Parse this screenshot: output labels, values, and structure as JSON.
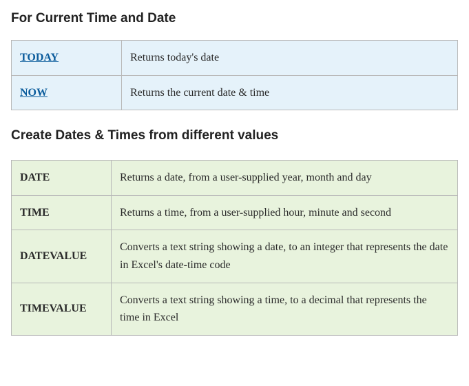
{
  "section1": {
    "heading": "For Current Time and Date",
    "rows": [
      {
        "name": "TODAY",
        "desc": "Returns today's date"
      },
      {
        "name": "NOW",
        "desc": "Returns the current date & time"
      }
    ]
  },
  "section2": {
    "heading": "Create Dates & Times from different values",
    "rows": [
      {
        "name": "DATE",
        "desc": "Returns a date, from a user-supplied year, month and day"
      },
      {
        "name": "TIME",
        "desc": "Returns a time, from a user-supplied hour, minute and second"
      },
      {
        "name": "DATEVALUE",
        "desc": "Converts a text string showing a date, to an integer that represents the   date in Excel's date-time code"
      },
      {
        "name": "TIMEVALUE",
        "desc": "Converts a text string showing a time, to a decimal that represents the time in Excel"
      }
    ]
  }
}
